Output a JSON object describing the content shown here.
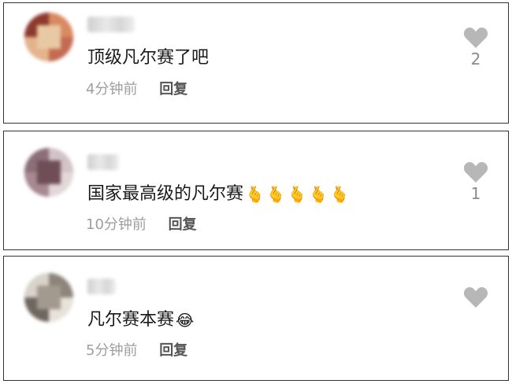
{
  "comments": [
    {
      "text": "顶级凡尔赛了吧",
      "emojis": [],
      "time": "4分钟前",
      "reply_label": "回复",
      "like_count": "2"
    },
    {
      "text": "国家最高级的凡尔赛",
      "emojis": [
        "🫰",
        "🫰",
        "🫰",
        "🫰",
        "🫰"
      ],
      "time": "10分钟前",
      "reply_label": "回复",
      "like_count": "1"
    },
    {
      "text": "凡尔赛本赛",
      "emojis": [
        "😂"
      ],
      "time": "5分钟前",
      "reply_label": "回复",
      "like_count": ""
    }
  ],
  "icons": {
    "avatar": "blurred-avatar-image",
    "like": "heart-icon"
  },
  "colors": {
    "heart": "#b7b7b7",
    "time_text": "#9e9e9e",
    "reply_text": "#555555",
    "comment_text": "#1a1a1a"
  }
}
